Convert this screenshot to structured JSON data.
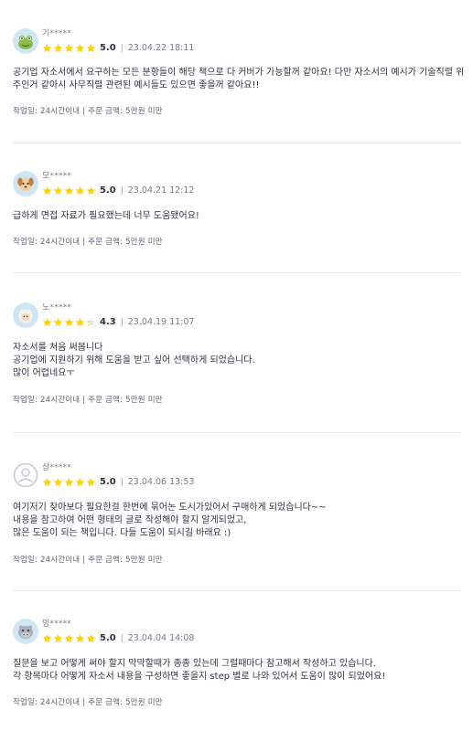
{
  "reviews": [
    {
      "username": "기*****",
      "score": "5.0",
      "rating": 5.0,
      "datetime": "23.04.22 18:11",
      "separator": "|",
      "lines": [
        "공기업 자소서에서 요구하는 모든 분항들이 해당 책으로 다 커버가 가능할꺼 같아요! 다만 자소서의 예시가 기술직렬 위",
        "주인거 같아시 사무직렬 관련된 예시들도 있으면 좋을꺼 같아요!!"
      ],
      "info": "작업일: 24시간이내 | 주문 금액: 5만원 미만",
      "avatar": "frog-avatar-icon"
    },
    {
      "username": "모*****",
      "score": "5.0",
      "rating": 5.0,
      "datetime": "23.04.21 12:12",
      "separator": "|",
      "lines": [
        "급하게 면접 자료가 필요했는데 너무 도움됐어요!"
      ],
      "info": "작업일: 24시간이내 | 주문 금액: 5만원 미만",
      "avatar": "dog-avatar-icon"
    },
    {
      "username": "노*****",
      "score": "4.3",
      "rating": 4.3,
      "datetime": "23.04.19 11:07",
      "separator": "|",
      "lines": [
        "자소서를 처음 써봅니다",
        "공기업에 지원하기 위해 도움을 받고 싶어 선택하게 되었습니다.",
        "많이 어렵네요ㅜ"
      ],
      "info": "작업일: 24시간이내 | 주문 금액: 5만원 미만",
      "avatar": "sheep-avatar-icon"
    },
    {
      "username": "상*****",
      "score": "5.0",
      "rating": 5.0,
      "datetime": "23.04.06 13:53",
      "separator": "|",
      "lines": [
        "여기저기 찾아보다 필요한걸 한번에 묶어논 도시가있어서 구매하게 되었습니다~~",
        "내용을 참고하여 어떤 형태의 글로 작성해야 할지 알게되었고,",
        "많은 도움이 되는 책입니다.  다들 도움이 되시길 바래요 :)"
      ],
      "info": "작업일: 24시간이내 | 주문 금액: 5만원 미만",
      "avatar": "default-avatar-icon"
    },
    {
      "username": "밍*****",
      "score": "5.0",
      "rating": 5.0,
      "datetime": "23.04.04 14:08",
      "separator": "|",
      "lines": [
        "질문을 보고 어떻게 써야 할지 막막할때가 종종 있는데 그럴때마다 참고해서 작성하고 있습니다.",
        "각 항목마다 어떻게 자소서 내용을 구성하면 좋을지 step 별로 나와 있어서 도움이 많이 되었어요!"
      ],
      "info": "작업일: 24시간이내 | 주문 금액: 5만원 미만",
      "avatar": "hippo-avatar-icon"
    }
  ],
  "colors": {
    "star_filled": "#ffd400",
    "star_empty": "#e4e5ed",
    "divider": "#e4e5ed",
    "text_primary": "#303441",
    "text_secondary": "#7a7d89"
  }
}
